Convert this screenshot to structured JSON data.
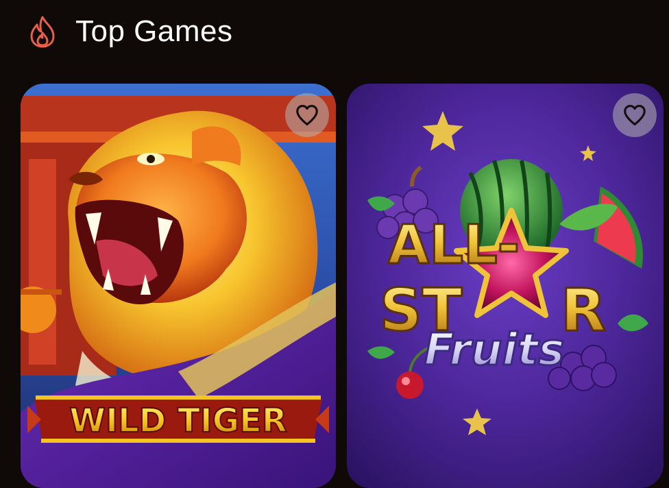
{
  "section": {
    "title": "Top Games",
    "icon": "fire-icon",
    "accent_color": "#e8604a"
  },
  "games": [
    {
      "title": "WILD TIGER",
      "favorite_icon": "heart-outline-icon"
    },
    {
      "title_line1": "ALL-",
      "title_line2_a": "ST",
      "title_line2_b": "R",
      "title_line3": "Fruits",
      "favorite_icon": "heart-outline-icon"
    }
  ]
}
